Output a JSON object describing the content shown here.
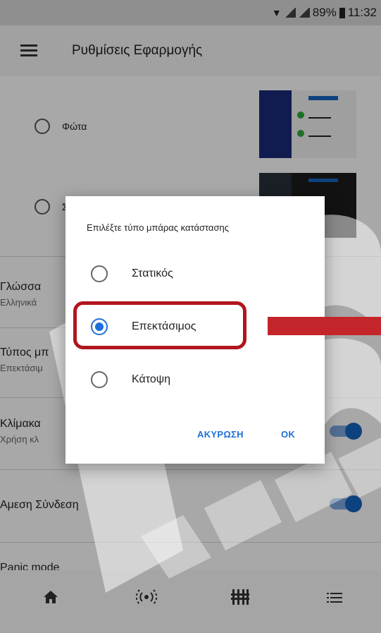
{
  "status_bar": {
    "battery": "89%",
    "time": "11:32"
  },
  "app_bar": {
    "title": "Ρυθμίσεις Εφαρμογής"
  },
  "settings": {
    "theme_options": [
      {
        "label": "Φώτα",
        "selected": false
      },
      {
        "label": "Σ",
        "selected": false
      }
    ],
    "language": {
      "title": "Γλώσσα",
      "value": "Ελληνικά"
    },
    "status_bar_type": {
      "title": "Τύπος μπ",
      "value": "Επεκτάσιμ"
    },
    "scale": {
      "title": "Κλίμακα",
      "value": "Χρήση κλ",
      "enabled": true
    },
    "direct_connection": {
      "title": "Αμεση Σύνδεση",
      "enabled": true
    },
    "panic_mode": {
      "title": "Panic mode"
    }
  },
  "bottom_nav": {
    "icons": [
      "home-icon",
      "sensors-icon",
      "equalizer-icon",
      "list-icon"
    ]
  },
  "dialog": {
    "title": "Επιλέξτε τύπο μπάρας κατάστασης",
    "options": [
      {
        "label": "Στατικός",
        "selected": false
      },
      {
        "label": "Επεκτάσιμος",
        "selected": true
      },
      {
        "label": "Κάτοψη",
        "selected": false
      }
    ],
    "cancel_label": "ΑΚΥΡΩΣΗ",
    "ok_label": "OK"
  },
  "colors": {
    "accent": "#1e6fd9",
    "highlight_red": "#b0161d"
  }
}
